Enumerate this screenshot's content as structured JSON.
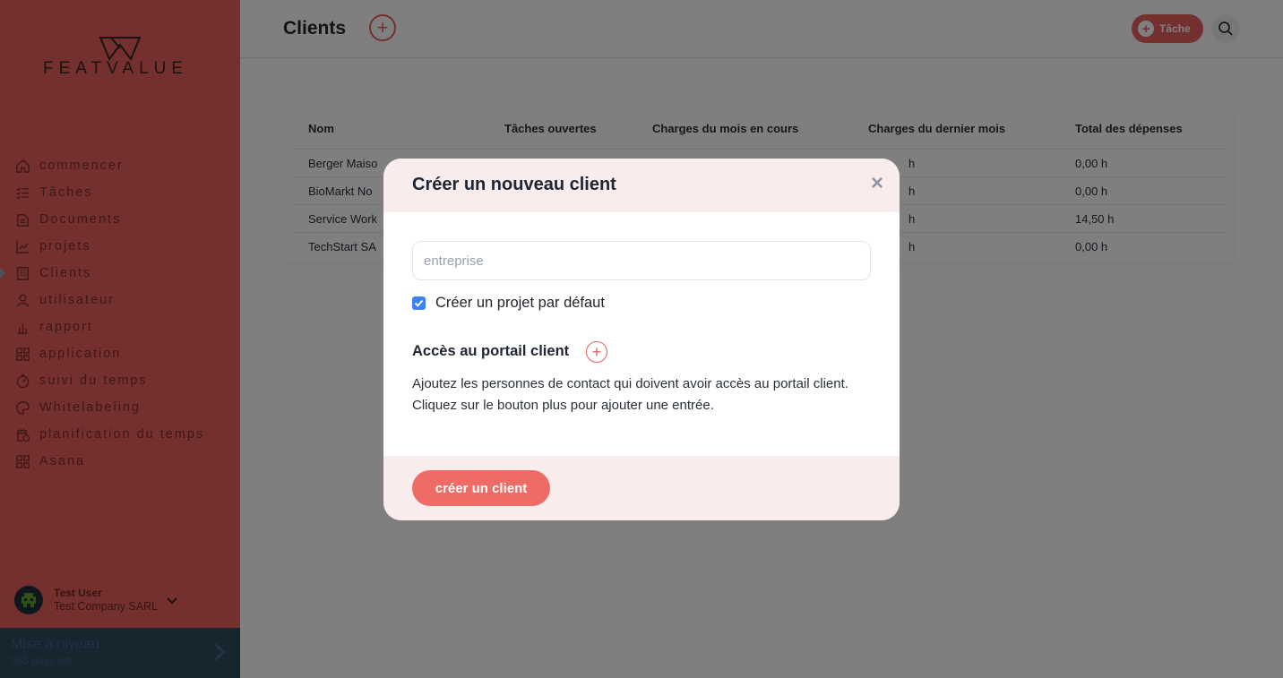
{
  "colors": {
    "accent": "#e8605d",
    "sidebar_bg": "#e8605d",
    "upgrade_bg": "#2f4a5e",
    "checkbox": "#3b82f6",
    "modal_header_bg": "#f9eced"
  },
  "logo": {
    "text": "FEATVALUE"
  },
  "sidebar": {
    "items": [
      {
        "label": "commencer",
        "icon": "home-icon"
      },
      {
        "label": "Tâches",
        "icon": "tasks-list-icon"
      },
      {
        "label": "Documents",
        "icon": "documents-icon"
      },
      {
        "label": "projets",
        "icon": "chart-icon"
      },
      {
        "label": "Clients",
        "icon": "building-icon",
        "active": true
      },
      {
        "label": "utilisateur",
        "icon": "user-icon"
      },
      {
        "label": "rapport",
        "icon": "report-icon"
      },
      {
        "label": "application",
        "icon": "apps-grid-icon"
      },
      {
        "label": "suivi du temps",
        "icon": "timer-icon"
      },
      {
        "label": "Whitelabeling",
        "icon": "palette-icon"
      },
      {
        "label": "planification du temps",
        "icon": "calendar-clock-icon"
      },
      {
        "label": "Asana",
        "icon": "apps-grid-icon"
      }
    ],
    "user": {
      "name": "Test User",
      "company": "Test Company SARL"
    },
    "upgrade": {
      "title": "Mise à niveau",
      "subtitle": "365 days left"
    }
  },
  "header": {
    "title": "Clients",
    "task_button": "Tâche"
  },
  "table": {
    "columns": [
      "Nom",
      "Tâches ouvertes",
      "Charges du mois en cours",
      "Charges du dernier mois",
      "Total des dépenses"
    ],
    "rows": [
      {
        "name": "Berger Maiso",
        "last_month": "h",
        "total": "0,00 h"
      },
      {
        "name": "BioMarkt No",
        "last_month": "h",
        "total": "0,00 h"
      },
      {
        "name": "Service Work",
        "last_month": "h",
        "total": "14,50 h"
      },
      {
        "name": "TechStart SA",
        "last_month": "h",
        "total": "0,00 h"
      }
    ]
  },
  "modal": {
    "title": "Créer un nouveau client",
    "company_placeholder": "entreprise",
    "company_value": "",
    "default_project_label": "Créer un projet par défaut",
    "default_project_checked": true,
    "portal_title": "Accès au portail client",
    "portal_description": "Ajoutez les personnes de contact qui doivent avoir accès au portail client. Cliquez sur le bouton plus pour ajouter une entrée.",
    "create_button": "créer un client",
    "close_symbol": "×"
  }
}
